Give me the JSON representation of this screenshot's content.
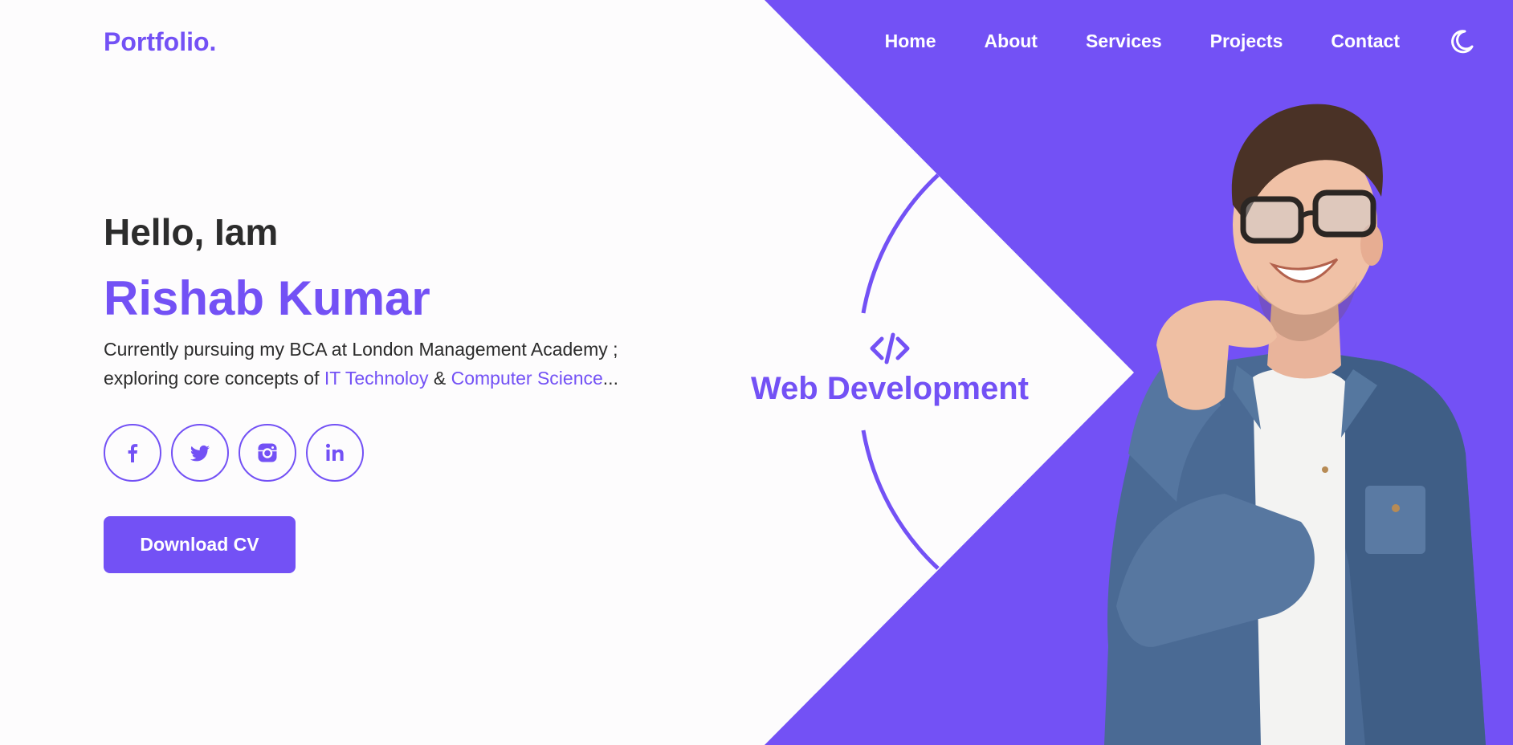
{
  "brand": {
    "logo": "Portfolio."
  },
  "nav": {
    "items": [
      "Home",
      "About",
      "Services",
      "Projects",
      "Contact"
    ],
    "theme_toggle_icon": "moon-icon"
  },
  "hero": {
    "greeting": "Hello, Iam",
    "name": "Rishab Kumar",
    "description": {
      "line1": "Currently pursuing my BCA at London Management Academy ;",
      "line2_prefix": "exploring core concepts of ",
      "highlight1": "IT Technoloy",
      "connector": " & ",
      "highlight2": "Computer Science",
      "suffix": "..."
    },
    "socials": [
      {
        "icon": "facebook-icon"
      },
      {
        "icon": "twitter-icon"
      },
      {
        "icon": "instagram-icon"
      },
      {
        "icon": "linkedin-icon"
      }
    ],
    "cta_label": "Download CV"
  },
  "specialty": {
    "icon": "code-icon",
    "label": "Web Development"
  },
  "portrait": {
    "subject": "smiling man with glasses in denim shirt"
  },
  "colors": {
    "accent": "#7351f5",
    "background": "#fdfcfd",
    "text": "#2c2c2c"
  }
}
